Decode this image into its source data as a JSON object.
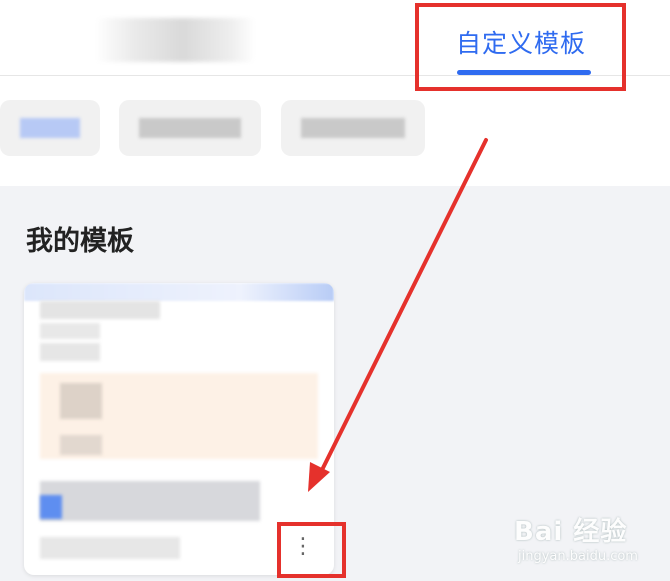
{
  "header": {
    "tabs": [
      {
        "label": "",
        "state": "inactive"
      },
      {
        "label": "自定义模板",
        "state": "active"
      }
    ],
    "accent_color": "#2f6bf0"
  },
  "filters": {
    "chips": [
      {
        "label": ""
      },
      {
        "label": ""
      },
      {
        "label": ""
      }
    ]
  },
  "main": {
    "section_title": "我的模板",
    "template_card": {
      "more_button_label": "⋮"
    }
  },
  "annotation": {
    "highlight_color": "#e5312c"
  },
  "watermark": {
    "brand": "Bai 经验",
    "url": "jingyan.baidu.com"
  }
}
